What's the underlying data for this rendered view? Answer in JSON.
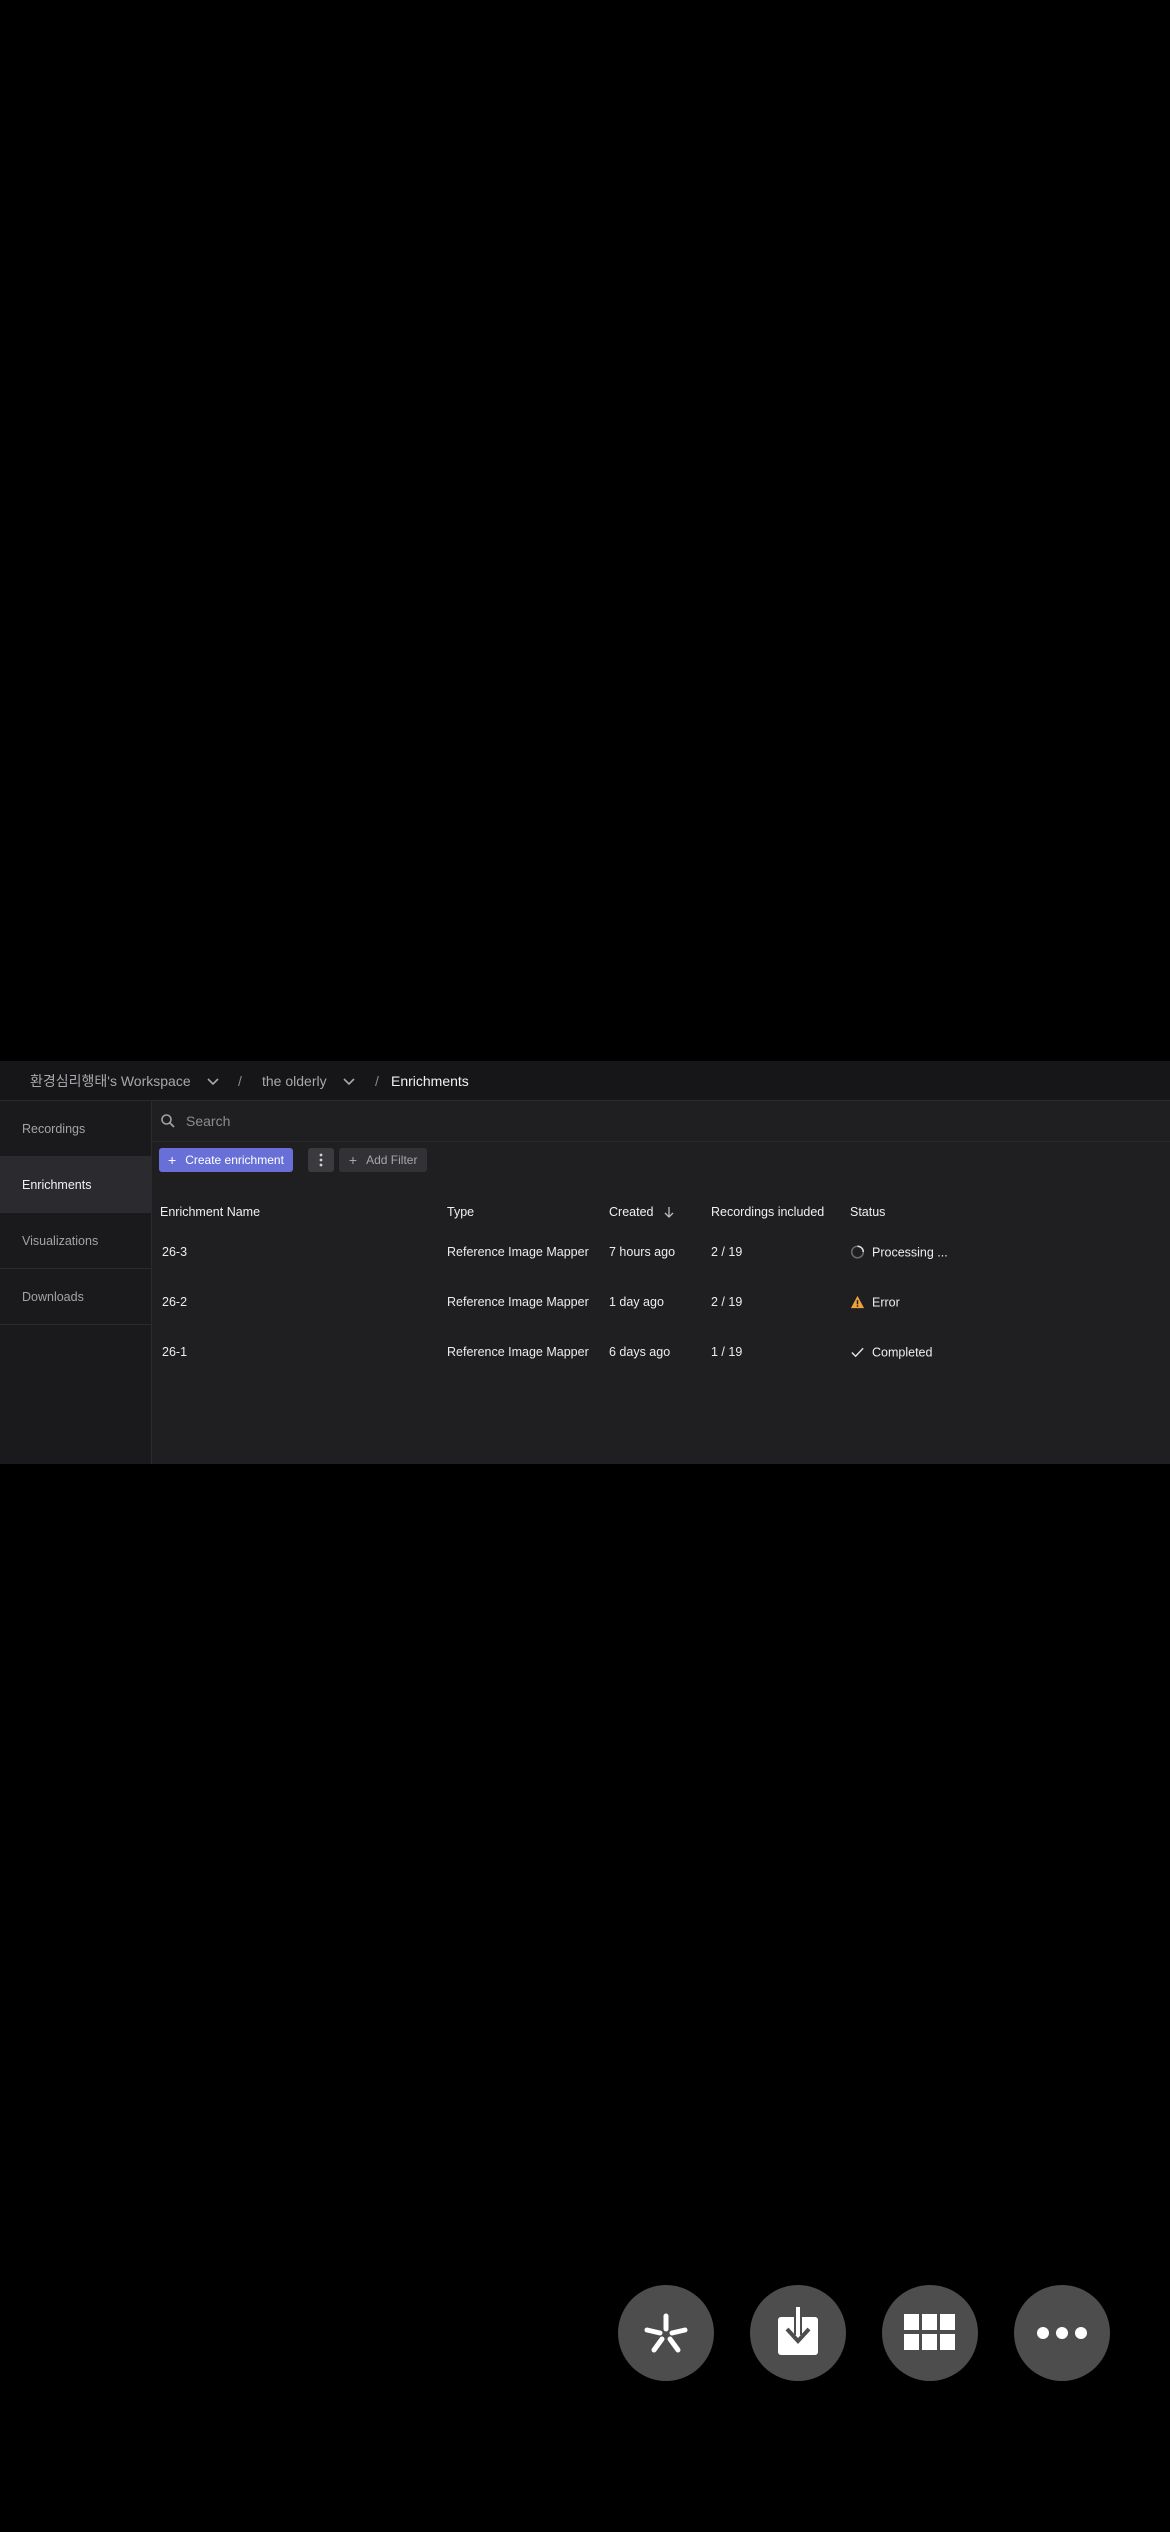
{
  "breadcrumb": {
    "workspace": "환경심리행태's Workspace",
    "project": "the olderly",
    "current": "Enrichments",
    "separator": "/"
  },
  "sidebar": {
    "items": [
      {
        "label": "Recordings",
        "active": false
      },
      {
        "label": "Enrichments",
        "active": true
      },
      {
        "label": "Visualizations",
        "active": false
      },
      {
        "label": "Downloads",
        "active": false
      }
    ]
  },
  "search": {
    "placeholder": "Search"
  },
  "toolbar": {
    "create_label": "Create enrichment",
    "filter_label": "Add Filter",
    "accent": "#6870d8"
  },
  "table": {
    "columns": [
      "Enrichment Name",
      "Type",
      "Created",
      "Recordings included",
      "Status"
    ],
    "sorted_column": "Created",
    "sort_direction": "descending",
    "rows": [
      {
        "name": "26-3",
        "type": "Reference Image Mapper",
        "created": "7 hours ago",
        "recordings": "2 / 19",
        "status": "Processing ...",
        "status_icon": "spinner-icon"
      },
      {
        "name": "26-2",
        "type": "Reference Image Mapper",
        "created": "1 day ago",
        "recordings": "2 / 19",
        "status": "Error",
        "status_icon": "warning-icon"
      },
      {
        "name": "26-1",
        "type": "Reference Image Mapper",
        "created": "6 days ago",
        "recordings": "1 / 19",
        "status": "Completed",
        "status_icon": "check-icon"
      }
    ]
  },
  "overlay_buttons": [
    "pinwheel-icon",
    "download-icon",
    "grid-icon",
    "more-icon"
  ],
  "colors": {
    "warning": "#f0a23a"
  }
}
